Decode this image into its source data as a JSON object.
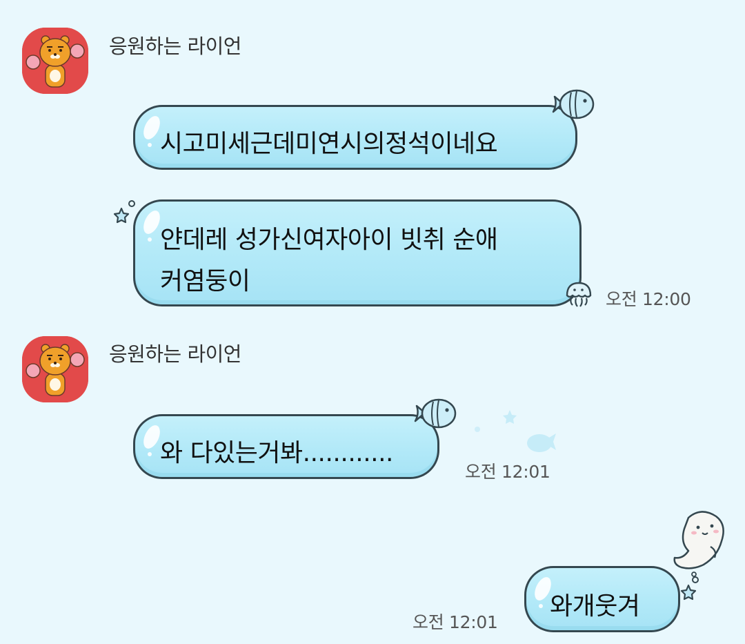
{
  "chat": {
    "messages": [
      {
        "sender": "응원하는 라이언",
        "avatar_icon": "ryan-cheering-avatar",
        "bubbles": [
          {
            "text": "시고미세근데미연시의정석이네요",
            "time": ""
          },
          {
            "lines": [
              "얀데레 성가신여자아이 빗취 순애",
              "커염둥이"
            ],
            "time": "오전 12:00"
          }
        ]
      },
      {
        "sender": "응원하는 라이언",
        "avatar_icon": "ryan-cheering-avatar",
        "bubbles": [
          {
            "text": "와 다있는거봐............",
            "time": "오전 12:01"
          }
        ]
      },
      {
        "sender": "",
        "outgoing": true,
        "bubbles": [
          {
            "text": "와개웃겨",
            "time": "오전 12:01"
          }
        ]
      }
    ]
  },
  "colors": {
    "background": "#e9f8fd",
    "bubble_fill": "#b2e9f8",
    "bubble_border": "#34474f",
    "avatar_bg": "#e24a4a"
  }
}
